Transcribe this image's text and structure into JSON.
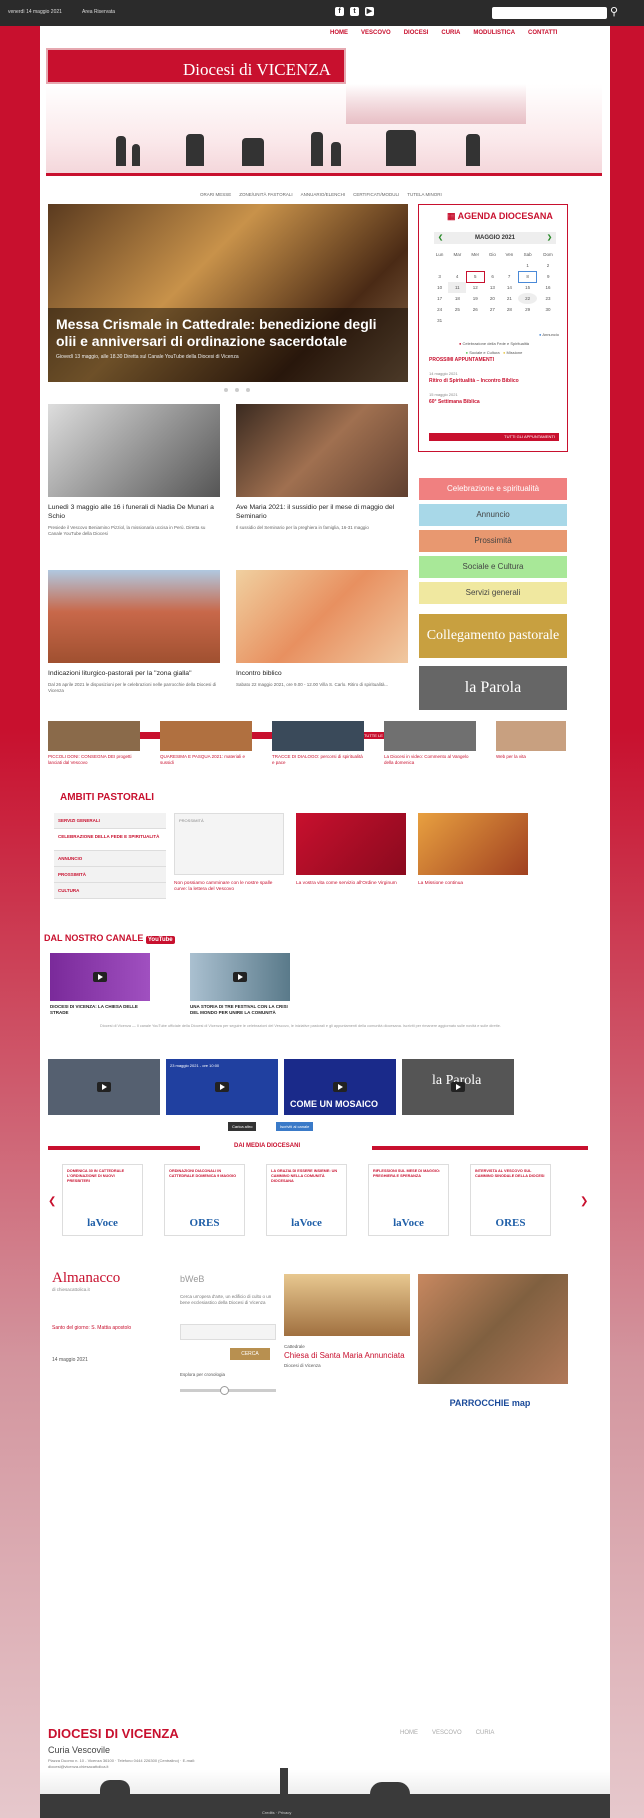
{
  "topbar": {
    "date": "venerdì 14 maggio 2021",
    "login": "Area Riservata",
    "search_placeholder": "",
    "social": [
      "f",
      "t",
      "▶"
    ]
  },
  "nav": {
    "items": [
      "HOME",
      "VESCOVO",
      "DIOCESI",
      "CURIA",
      "MODULISTICA",
      "CONTATTI"
    ]
  },
  "logo": {
    "title": "Diocesi di VICENZA"
  },
  "subnav": [
    "ORARI MESSE",
    "ZONE/UNITÀ PASTORALI",
    "ANNUARIO/ELENCHI",
    "CERTIFICATI/MODULI",
    "TUTELA MINORI"
  ],
  "hero": {
    "title": "Messa Crismale in Cattedrale: benedizione degli olii e anniversari di ordinazione sacerdotale",
    "subtitle": "Giovedì 13 maggio, alle 18.30 Diretta sul Canale YouTube della Diocesi di Vicenza"
  },
  "agenda": {
    "heading": "AGENDA DIOCESANA",
    "month": "MAGGIO 2021",
    "weekdays": [
      "Lun",
      "Mar",
      "Mer",
      "Gio",
      "Ven",
      "Sab",
      "Dom"
    ],
    "weeks": [
      [
        "",
        "",
        "",
        "",
        "",
        "1",
        "2"
      ],
      [
        "3",
        "4",
        "5",
        "6",
        "7",
        "8",
        "9"
      ],
      [
        "10",
        "11",
        "12",
        "13",
        "14",
        "15",
        "16"
      ],
      [
        "17",
        "18",
        "19",
        "20",
        "21",
        "22",
        "23"
      ],
      [
        "24",
        "25",
        "26",
        "27",
        "28",
        "29",
        "30"
      ],
      [
        "31",
        "",
        "",
        "",
        "",
        "",
        ""
      ]
    ],
    "legend": [
      "Annuncio",
      "Celebrazione della Fede e Spiritualità",
      "Sociale e Cultura",
      "Missione"
    ],
    "appt_heading": "PROSSIMI APPUNTAMENTI",
    "appts": [
      {
        "date": "14 maggio 2021",
        "title": "Ritiro di Spiritualità – Incontro Biblico"
      },
      {
        "date": "15 maggio 2021",
        "title": "60° Settimana Biblica"
      }
    ],
    "all_btn": "TUTTI GLI APPUNTAMENTI"
  },
  "news": [
    {
      "title": "Lunedì 3 maggio alle 16 i funerali di Nadia De Munari a Schio",
      "desc": "Presiede il Vescovo Beniamino Pizziol, la missionaria uccisa in Perù. Diretta su Canale YouTube della Diocesi"
    },
    {
      "title": "Ave Maria 2021: il sussidio per il mese di maggio del Seminario",
      "desc": "Il sussidio del Seminario per la preghiera in famiglia, 16-31 maggio"
    },
    {
      "title": "Indicazioni liturgico-pastorali per la \"zona gialla\"",
      "desc": "Dal 26 aprile 2021 le disposizioni per le celebrazioni nelle parrocchie della Diocesi di Vicenza"
    },
    {
      "title": "Incontro biblico",
      "desc": "Sabato 22 maggio 2021, ore 9.00 - 12.00 Villa S. Carlo. Ritiro di spiritualità..."
    }
  ],
  "categories": [
    "Celebrazione e spiritualità",
    "Annuncio",
    "Prossimità",
    "Sociale e Cultura",
    "Servizi generali"
  ],
  "banners": [
    "Collegamento pastorale",
    "la Parola"
  ],
  "allnews": "TUTTE LE NEWS",
  "thumbs": [
    {
      "title": "PICCOLI DONI: CONSEGNA DEI progetti lanciati dal Vescovo"
    },
    {
      "title": "QUARESIMA E PASQUA 2021: materiali e sussidi"
    },
    {
      "title": "TRACCE DI DIALOGO: percorsi di spiritualità e pace"
    },
    {
      "title": "La Diocesi in video: Commento al Vangelo della domenica"
    },
    {
      "title": "Web per la vita"
    }
  ],
  "ambiti": {
    "title": "AMBITI PASTORALI",
    "items": [
      "SERVIZI GENERALI",
      "CELEBRAZIONE DELLA FEDE E SPIRITUALITÀ",
      "ANNUNCIO",
      "PROSSIMITÀ",
      "CULTURA"
    ],
    "cards": [
      {
        "label": "PROSSIMITÀ",
        "title": "Non possiamo camminare con le nostre spalle curve: la lettera del Vescovo"
      },
      {
        "title": "La vostra vita come servizio all'Ordine Virginum"
      },
      {
        "title": "La Missione continua"
      }
    ]
  },
  "channel": {
    "title": "DAL NOSTRO CANALE",
    "videos": [
      {
        "title": "DIOCESI DI VICENZA: LA CHIESA DELLE STRADE"
      },
      {
        "title": "UNA STORIA DI TRE FESTIVAL CON LA CRISI DEL MONDO PER UNIRE LA COMUNITÀ"
      }
    ],
    "desc": "Diocesi di Vicenza — Il canale YouTube ufficiale della Diocesi di Vicenza per seguire le celebrazioni del Vescovo, le iniziative pastorali e gli appuntamenti della comunità diocesana. Iscriviti per rimanere aggiornato sulle novità e sulle dirette.",
    "yt": [
      "",
      "23 maggio 2021 - ore 10:00",
      "COME UN MOSAICO",
      "la Parola"
    ],
    "buttons": [
      "Carica altro",
      "Iscriviti al canale"
    ]
  },
  "media": {
    "title": "DAI MEDIA DIOCESANI",
    "cards": [
      {
        "title": "DOMENICA 30 IN CATTEDRALE L'ORDINAZIONE DI NUOVI PRESBITERI",
        "logo": "laVoce"
      },
      {
        "title": "ORDINAZIONI DIACONALI IN CATTEDRALE DOMENICA 9 MAGGIO",
        "logo": "ORES"
      },
      {
        "title": "LA GRAZIA DI ESSERE INSIEME: UN CAMMINO NELLA COMUNITÀ DIOCESANA",
        "logo": "laVoce"
      },
      {
        "title": "RIFLESSIONI SUL MESE DI MAGGIO: PREGHIERA E SPERANZA",
        "logo": "laVoce"
      },
      {
        "title": "INTERVISTA AL VESCOVO SUL CAMMINO SINODALE DELLA DIOCESI",
        "logo": "ORES"
      }
    ]
  },
  "almanacco": {
    "title": "Almanacco",
    "sub": "di chiesacattolica.it",
    "links": [
      "Santo del giorno: S. Mattia apostolo",
      "14 maggio 2021"
    ]
  },
  "bweb": {
    "title": "bWeB",
    "desc": "Cerca un'opera d'arte, un edificio di culto o un bene ecclesiastico della Diocesi di Vicenza",
    "btn": "CERCA",
    "timeline": "Esplora per cronologia"
  },
  "chiesa": {
    "label": "Cattedrale",
    "title": "Chiesa di Santa Maria Annunciata",
    "sub": "Diocesi di Vicenza"
  },
  "parrocchie": {
    "label": "PARROCCHIE map"
  },
  "footer": {
    "title": "DIOCESI DI VICENZA",
    "sub": "Curia Vescovile",
    "addr": "Piazza Duomo n. 10 - Vicenza 36100 · Telefono 0444 226300 (Centralino) · E-mail: diocesi@vicenza.chiesacattolica.it",
    "nav": [
      "HOME",
      "VESCOVO",
      "CURIA"
    ],
    "copy": "Credits · Privacy"
  }
}
